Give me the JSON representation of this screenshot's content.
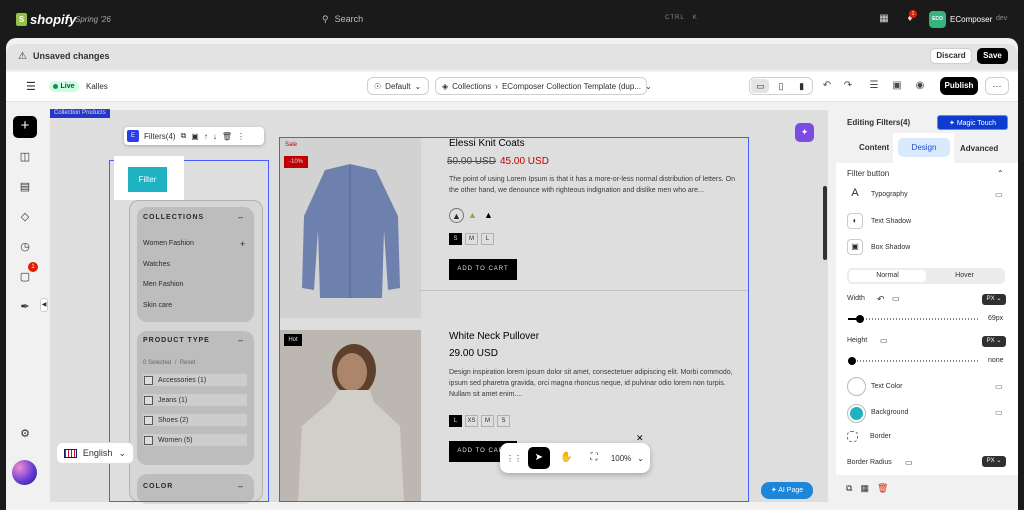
{
  "topbar": {
    "logo": "shopify",
    "edition": "Spring '26",
    "search_placeholder": "Search",
    "shortcut_ctrl": "CTRL",
    "shortcut_key": "K",
    "notification_count": "1",
    "user_initials": "ECO",
    "user_name": "EComposer",
    "user_suffix": "dev"
  },
  "unsaved": {
    "text": "Unsaved changes",
    "discard": "Discard",
    "save": "Save"
  },
  "toolbar": {
    "live": "Live",
    "theme": "Kalles",
    "template": "Default",
    "breadcrumb_root": "Collections",
    "breadcrumb_page": "EComposer Collection Template (dup...",
    "publish": "Publish"
  },
  "sidebar": {
    "badge": "1",
    "language": "English"
  },
  "canvas": {
    "section_tag": "Collection Products",
    "toolbar_label": "Filters(4)",
    "filter_button": "Filter",
    "collections_title": "COLLECTIONS",
    "collections": [
      "Women Fashion",
      "Watches",
      "Men Fashion",
      "Skin care"
    ],
    "product_type_title": "PRODUCT TYPE",
    "selected": "0 Selected",
    "reset": "Reset",
    "product_types": [
      "Accessories (1)",
      "Jeans (1)",
      "Shoes (2)",
      "Women (5)"
    ],
    "color_title": "COLOR",
    "products": [
      {
        "name": "Elessi Knit Coats",
        "old_price": "50.00 USD",
        "price": "45.00 USD",
        "sale": "Sale",
        "discount": "-10%",
        "desc": "The point of using Lorem Ipsum is that it has a more-or-less normal distribution of letters. On the other hand, we denounce with righteous indignation and dislike men who are...",
        "sizes": [
          "S",
          "M",
          "L"
        ],
        "cta": "ADD TO CART"
      },
      {
        "name": "White Neck Pullover",
        "price": "29.00 USD",
        "tag": "Hot",
        "desc": "Design inspiration lorem ipsum dolor sit amet, consectetuer adipiscing elit. Morbi commodo, ipsum sed pharetra gravida, orci magna rhoncus neque, id pulvinar odio lorem non turpis. Nullam sit amet enim....",
        "sizes": [
          "L",
          "XS",
          "M",
          "S"
        ],
        "cta": "ADD TO CART"
      }
    ],
    "zoom": "100%",
    "ai_page": "AI Page"
  },
  "panel": {
    "title": "Editing Filters(4)",
    "magic_touch": "Magic Touch",
    "tabs": [
      "Content",
      "Design",
      "Advanced"
    ],
    "section": "Filter button",
    "typography": "Typography",
    "text_shadow": "Text Shadow",
    "box_shadow": "Box Shadow",
    "state_normal": "Normal",
    "state_hover": "Hover",
    "width_label": "Width",
    "unit": "PX",
    "width_value": "69px",
    "height_label": "Height",
    "height_value": "none",
    "text_color": "Text Color",
    "background": "Background",
    "border": "Border",
    "border_radius": "Border Radius",
    "background_color": "#1fb2c3",
    "accent": "#2c3ee8"
  }
}
